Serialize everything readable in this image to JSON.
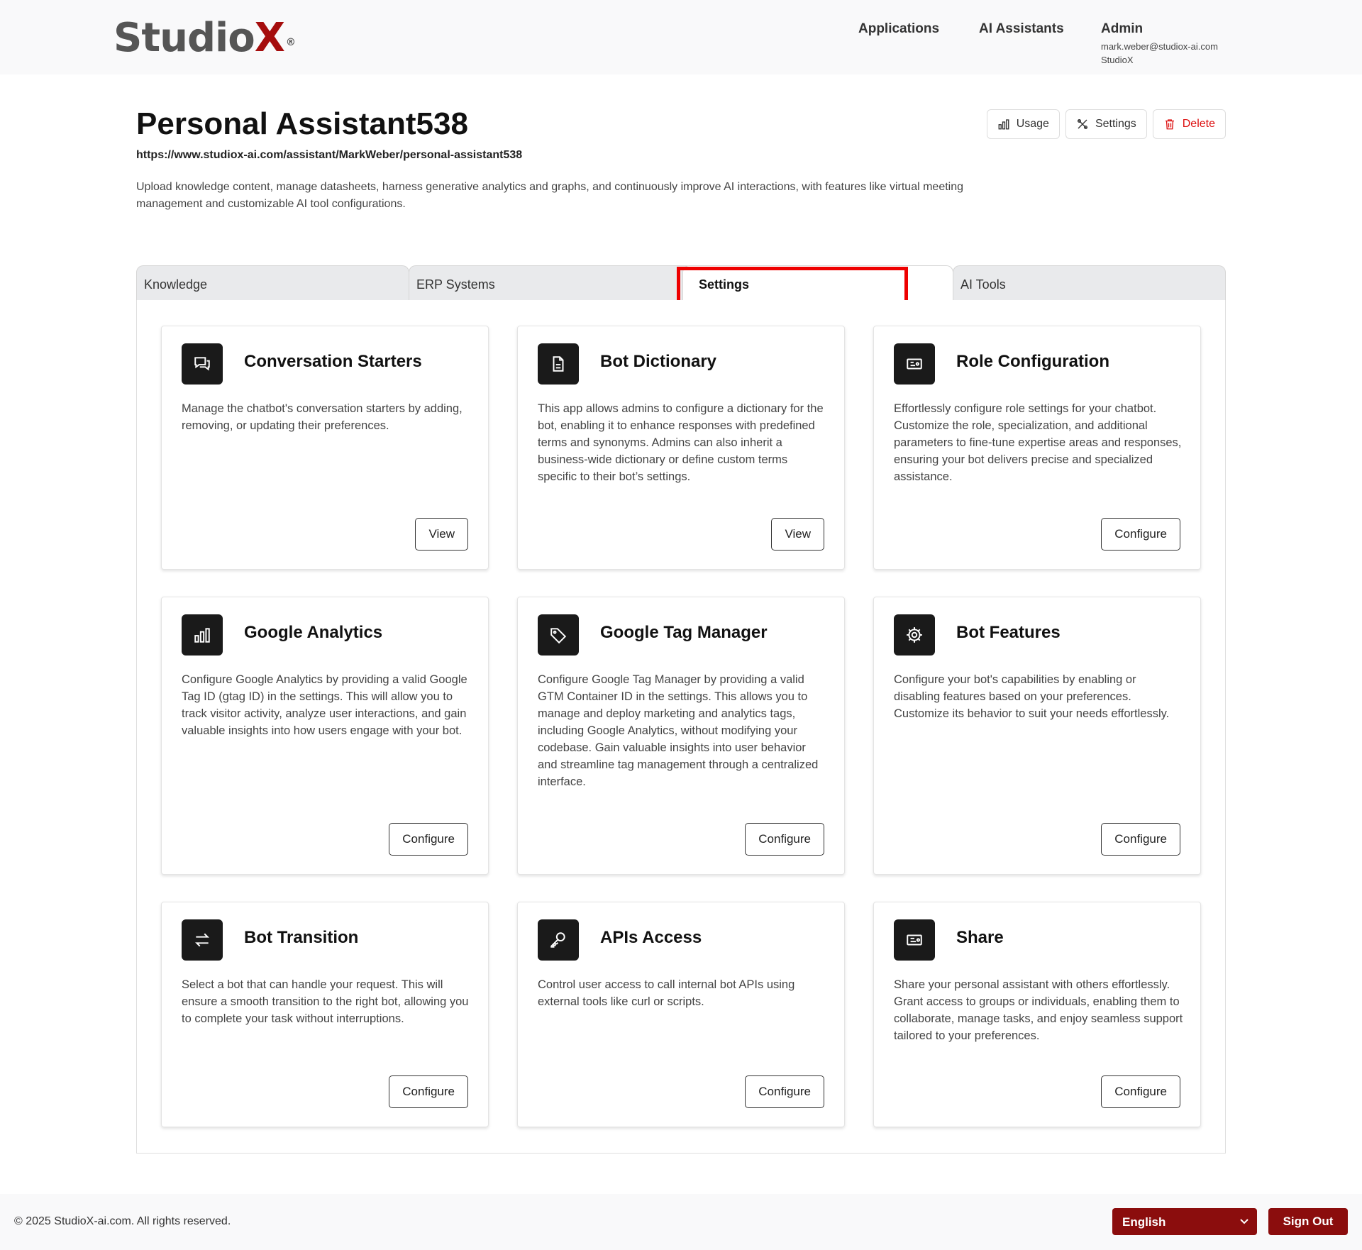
{
  "header": {
    "logo_main": "Studio",
    "logo_x": "X",
    "logo_reg": "®",
    "nav_applications": "Applications",
    "nav_ai_assistants": "AI Assistants",
    "admin_name": "Admin",
    "admin_email": "mark.weber@studiox-ai.com",
    "admin_org": "StudioX"
  },
  "assistant": {
    "title": "Personal Assistant538",
    "url": "https://www.studiox-ai.com/assistant/MarkWeber/personal-assistant538",
    "description": "Upload knowledge content, manage datasheets, harness generative analytics and graphs, and continuously improve AI interactions, with features like virtual meeting management and customizable AI tool configurations."
  },
  "actions": {
    "usage": "Usage",
    "settings": "Settings",
    "delete": "Delete"
  },
  "tabs": [
    {
      "label": "Knowledge"
    },
    {
      "label": "ERP Systems"
    },
    {
      "label": "Settings",
      "active": true
    },
    {
      "label": "AI Tools"
    }
  ],
  "cards": [
    {
      "title": "Conversation Starters",
      "icon": "chat-bubbles-icon",
      "description": "Manage the chatbot's conversation starters by adding, removing, or updating their preferences.",
      "button": "View"
    },
    {
      "title": "Bot Dictionary",
      "icon": "document-icon",
      "description": "This app allows admins to configure a dictionary for the bot, enabling it to enhance responses with predefined terms and synonyms. Admins can also inherit a business-wide dictionary or define custom terms specific to their bot’s settings.",
      "button": "View"
    },
    {
      "title": "Role Configuration",
      "icon": "id-card-icon",
      "description": "Effortlessly configure role settings for your chatbot. Customize the role, specialization, and additional parameters to fine-tune expertise areas and responses, ensuring your bot delivers precise and specialized assistance.",
      "button": "Configure"
    },
    {
      "title": "Google Analytics",
      "icon": "bar-chart-icon",
      "description": "Configure Google Analytics by providing a valid Google Tag ID (gtag ID) in the settings. This will allow you to track visitor activity, analyze user interactions, and gain valuable insights into how users engage with your bot.",
      "button": "Configure"
    },
    {
      "title": "Google Tag Manager",
      "icon": "tag-icon",
      "description": "Configure Google Tag Manager by providing a valid GTM Container ID in the settings. This allows you to manage and deploy marketing and analytics tags, including Google Analytics, without modifying your codebase. Gain valuable insights into user behavior and streamline tag management through a centralized interface.",
      "button": "Configure"
    },
    {
      "title": "Bot Features",
      "icon": "gear-icon",
      "description": "Configure your bot's capabilities by enabling or disabling features based on your preferences. Customize its behavior to suit your needs effortlessly.",
      "button": "Configure"
    },
    {
      "title": "Bot Transition",
      "icon": "arrows-exchange-icon",
      "description": "Select a bot that can handle your request. This will ensure a smooth transition to the right bot, allowing you to complete your task without interruptions.",
      "button": "Configure"
    },
    {
      "title": "APIs Access",
      "icon": "key-icon",
      "description": "Control user access to call internal bot APIs using external tools like curl or scripts.",
      "button": "Configure"
    },
    {
      "title": "Share",
      "icon": "ticket-icon",
      "description": "Share your personal assistant with others effortlessly. Grant access to groups or individuals, enabling them to collaborate, manage tasks, and enjoy seamless support tailored to your preferences.",
      "button": "Configure"
    }
  ],
  "footer": {
    "copyright": "© 2025 StudioX-ai.com.  All rights reserved.",
    "language": "English",
    "sign_out": "Sign Out"
  },
  "colors": {
    "brand_red": "#a50d0d",
    "footer_button": "#8b0d0d",
    "delete_red": "#dd1111",
    "highlight_box": "#ee0000"
  }
}
